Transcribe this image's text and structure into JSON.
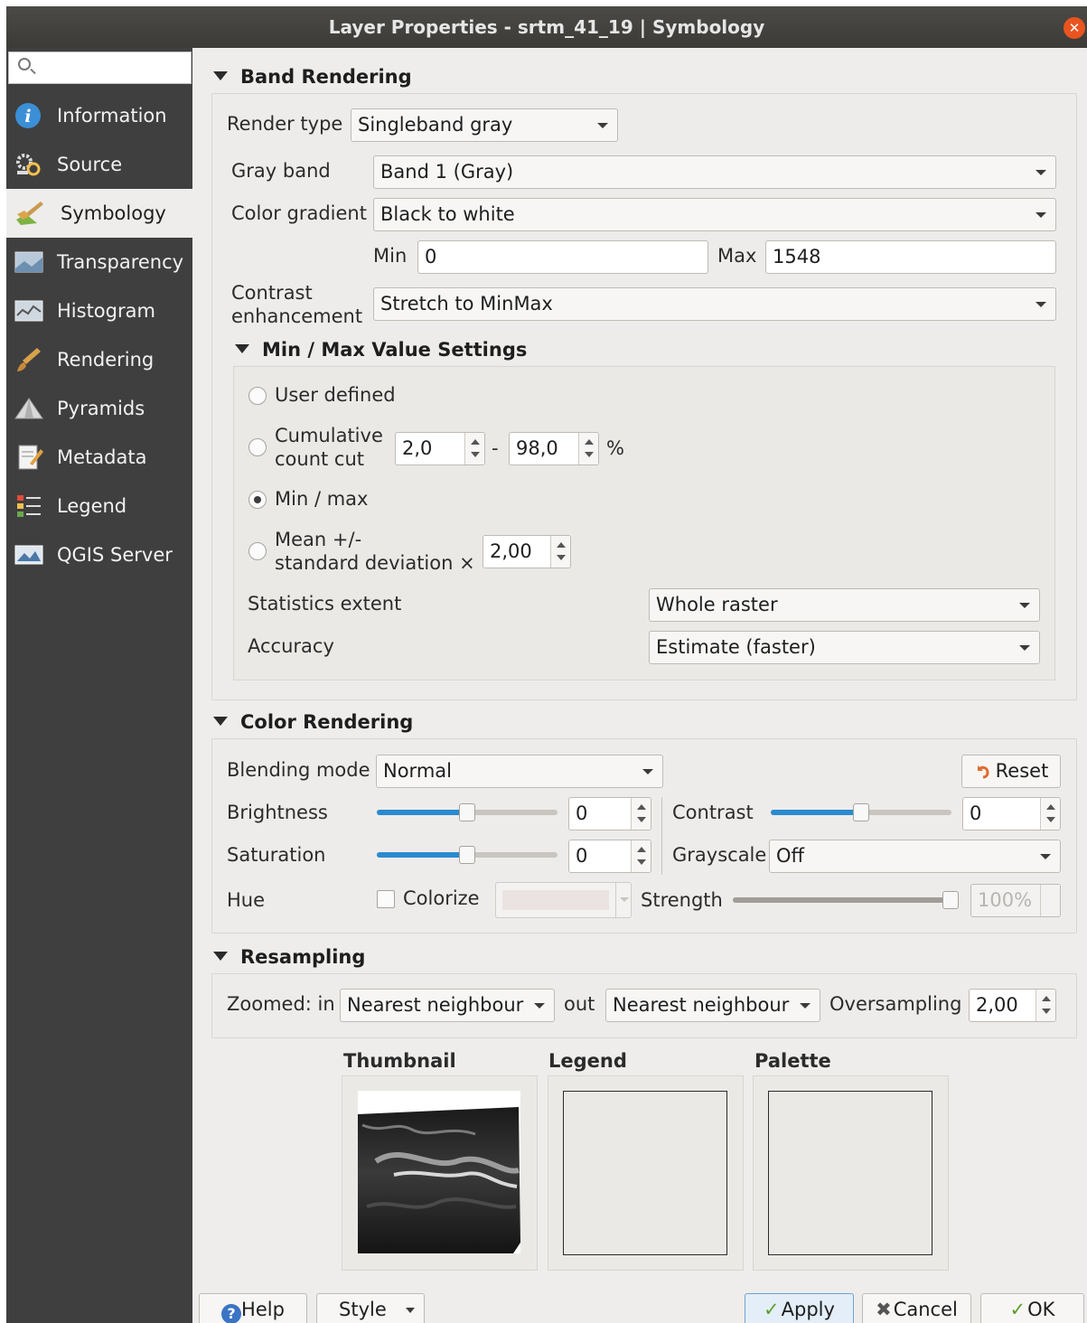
{
  "window": {
    "title": "Layer Properties - srtm_41_19 | Symbology",
    "close_glyph": "✕"
  },
  "sidebar": {
    "search_placeholder": "",
    "items": [
      {
        "label": "Information",
        "icon": "information-icon"
      },
      {
        "label": "Source",
        "icon": "source-icon"
      },
      {
        "label": "Symbology",
        "icon": "symbology-icon"
      },
      {
        "label": "Transparency",
        "icon": "transparency-icon"
      },
      {
        "label": "Histogram",
        "icon": "histogram-icon"
      },
      {
        "label": "Rendering",
        "icon": "rendering-icon"
      },
      {
        "label": "Pyramids",
        "icon": "pyramids-icon"
      },
      {
        "label": "Metadata",
        "icon": "metadata-icon"
      },
      {
        "label": "Legend",
        "icon": "legend-icon"
      },
      {
        "label": "QGIS Server",
        "icon": "qgis-server-icon"
      }
    ],
    "active": "Symbology"
  },
  "band_rendering": {
    "header": "Band Rendering",
    "render_type_label": "Render type",
    "render_type": "Singleband gray",
    "gray_band_label": "Gray band",
    "gray_band": "Band 1 (Gray)",
    "color_gradient_label": "Color gradient",
    "color_gradient": "Black to white",
    "min_label": "Min",
    "min_value": "0",
    "max_label": "Max",
    "max_value": "1548",
    "contrast_label_1": "Contrast",
    "contrast_label_2": "enhancement",
    "contrast": "Stretch to MinMax",
    "minmax": {
      "header": "Min / Max Value Settings",
      "user_defined": "User defined",
      "cumulative_1": "Cumulative",
      "cumulative_2": "count cut",
      "cum_low": "2,0",
      "cum_dash": "-",
      "cum_high": "98,0",
      "cum_pct": "%",
      "min_max": "Min / max",
      "mean_1": "Mean +/-",
      "mean_2": "standard deviation ×",
      "mean_value": "2,00",
      "selected": "Min / max",
      "stats_extent_label": "Statistics extent",
      "stats_extent": "Whole raster",
      "accuracy_label": "Accuracy",
      "accuracy": "Estimate (faster)"
    }
  },
  "color_rendering": {
    "header": "Color Rendering",
    "blending_label": "Blending mode",
    "blending": "Normal",
    "reset_label": "Reset",
    "brightness_label": "Brightness",
    "brightness_value": "0",
    "brightness_level": 0.5,
    "contrast_label": "Contrast",
    "contrast_value": "0",
    "contrast_level": 0.5,
    "saturation_label": "Saturation",
    "saturation_value": "0",
    "saturation_level": 0.5,
    "grayscale_label": "Grayscale",
    "grayscale": "Off",
    "hue_label": "Hue",
    "colorize_label": "Colorize",
    "colorize_checked": false,
    "strength_label": "Strength",
    "strength_value": "100%",
    "strength_level": 1.0
  },
  "resampling": {
    "header": "Resampling",
    "zoomed_in_label": "Zoomed: in",
    "zoomed_in": "Nearest neighbour",
    "out_label": "out",
    "zoomed_out": "Nearest neighbour",
    "oversampling_label": "Oversampling",
    "oversampling_value": "2,00"
  },
  "previews": {
    "thumbnail_label": "Thumbnail",
    "legend_label": "Legend",
    "palette_label": "Palette"
  },
  "buttons": {
    "help": "Help",
    "style": "Style",
    "apply": "Apply",
    "cancel": "Cancel",
    "ok": "OK"
  },
  "colors": {
    "accent": "#2a8ad0",
    "sidebar_bg": "#3f3f3f",
    "titlebar_bg": "#3c3b37",
    "close_btn": "#e95420"
  }
}
